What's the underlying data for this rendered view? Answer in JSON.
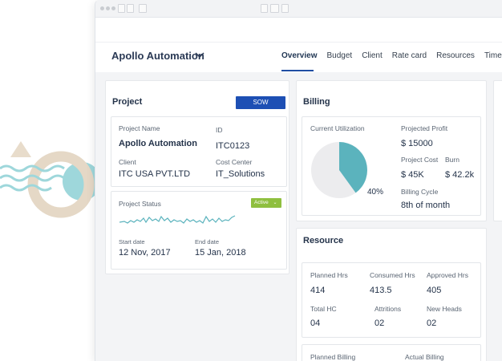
{
  "header": {
    "project_name": "Apollo Automation",
    "tabs": [
      "Overview",
      "Budget",
      "Client",
      "Rate card",
      "Resources",
      "Timesheet"
    ],
    "active_tab": "Overview"
  },
  "project_card": {
    "title": "Project",
    "sow_button": "SOW",
    "project_name_label": "Project Name",
    "project_name_value": "Apollo Automation",
    "id_label": "ID",
    "id_value": "ITC0123",
    "client_label": "Client",
    "client_value": "ITC USA PVT.LTD",
    "cost_center_label": "Cost Center",
    "cost_center_value": "IT_Solutions",
    "status_label": "Project Status",
    "status_badge": "Active",
    "start_label": "Start date",
    "start_value": "12 Nov, 2017",
    "end_label": "End date",
    "end_value": "15 Jan, 2018"
  },
  "billing_card": {
    "title": "Billing",
    "utilization_label": "Current Utilization",
    "utilization_value": "40%",
    "utilization_fraction": 0.4,
    "projected_profit_label": "Projected Profit",
    "projected_profit_value": "$ 15000",
    "project_cost_label": "Project Cost",
    "project_cost_value": "$ 45K",
    "burn_label": "Burn",
    "burn_value": "$ 42.2k",
    "billing_cycle_label": "Billing Cycle",
    "billing_cycle_value": "8th of month"
  },
  "resource_card": {
    "title": "Resource",
    "planned_hrs_label": "Planned Hrs",
    "planned_hrs_value": "414",
    "consumed_hrs_label": "Consumed Hrs",
    "consumed_hrs_value": "413.5",
    "approved_hrs_label": "Approved Hrs",
    "approved_hrs_value": "405",
    "total_hc_label": "Total HC",
    "total_hc_value": "04",
    "attritions_label": "Attritions",
    "attritions_value": "02",
    "new_heads_label": "New Heads",
    "new_heads_value": "02",
    "planned_billing_label": "Planned Billing",
    "actual_billing_label": "Actual Billing"
  },
  "colors": {
    "accent": "#1d4fb4",
    "teal": "#5bb3bd",
    "active_badge": "#8fbf3f",
    "pie_rest": "#ececee"
  }
}
